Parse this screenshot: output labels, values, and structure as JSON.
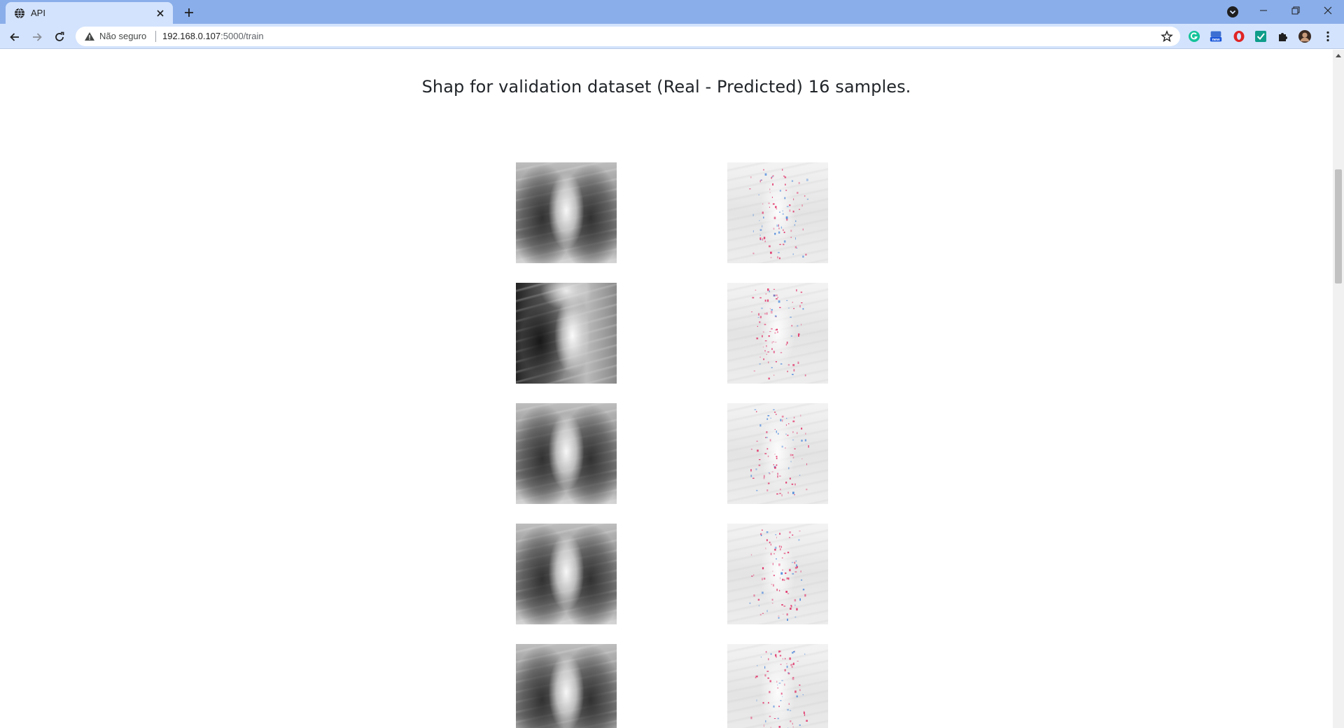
{
  "browser": {
    "tab": {
      "title": "API"
    },
    "omnibox": {
      "security_label": "Não seguro",
      "url_host": "192.168.0.107",
      "url_path": ":5000/train"
    },
    "icons": {
      "tab_favicon": "globe-icon",
      "tab_close": "close-icon",
      "new_tab": "plus-icon",
      "tab_search": "tab-search-icon",
      "back": "arrow-left-icon",
      "forward": "arrow-right-icon",
      "reload": "reload-icon",
      "security": "warning-triangle-icon",
      "bookmark": "star-icon",
      "extensions": [
        "grammarly-icon",
        "extension-new-icon",
        "opera-icon",
        "checkmark-extension-icon",
        "puzzle-icon",
        "profile-avatar-icon",
        "kebab-menu-icon"
      ]
    },
    "extension_badge": "new",
    "colors": {
      "tabbar": "#8aaee9",
      "toolbar": "#d3e3fd",
      "page_bg": "#ffffff"
    }
  },
  "page": {
    "title": "Shap for validation dataset (Real - Predicted) 16 samples.",
    "samples": [
      {
        "real_image": "chest-xray-real-1",
        "shap_image": "shap-map-1"
      },
      {
        "real_image": "chest-xray-real-2",
        "shap_image": "shap-map-2"
      },
      {
        "real_image": "chest-xray-real-3",
        "shap_image": "shap-map-3"
      },
      {
        "real_image": "chest-xray-real-4",
        "shap_image": "shap-map-4"
      },
      {
        "real_image": "chest-xray-real-5",
        "shap_image": "shap-map-5"
      }
    ],
    "shap_colors": {
      "positive": "#e0245e",
      "negative": "#3b7dd8"
    }
  }
}
